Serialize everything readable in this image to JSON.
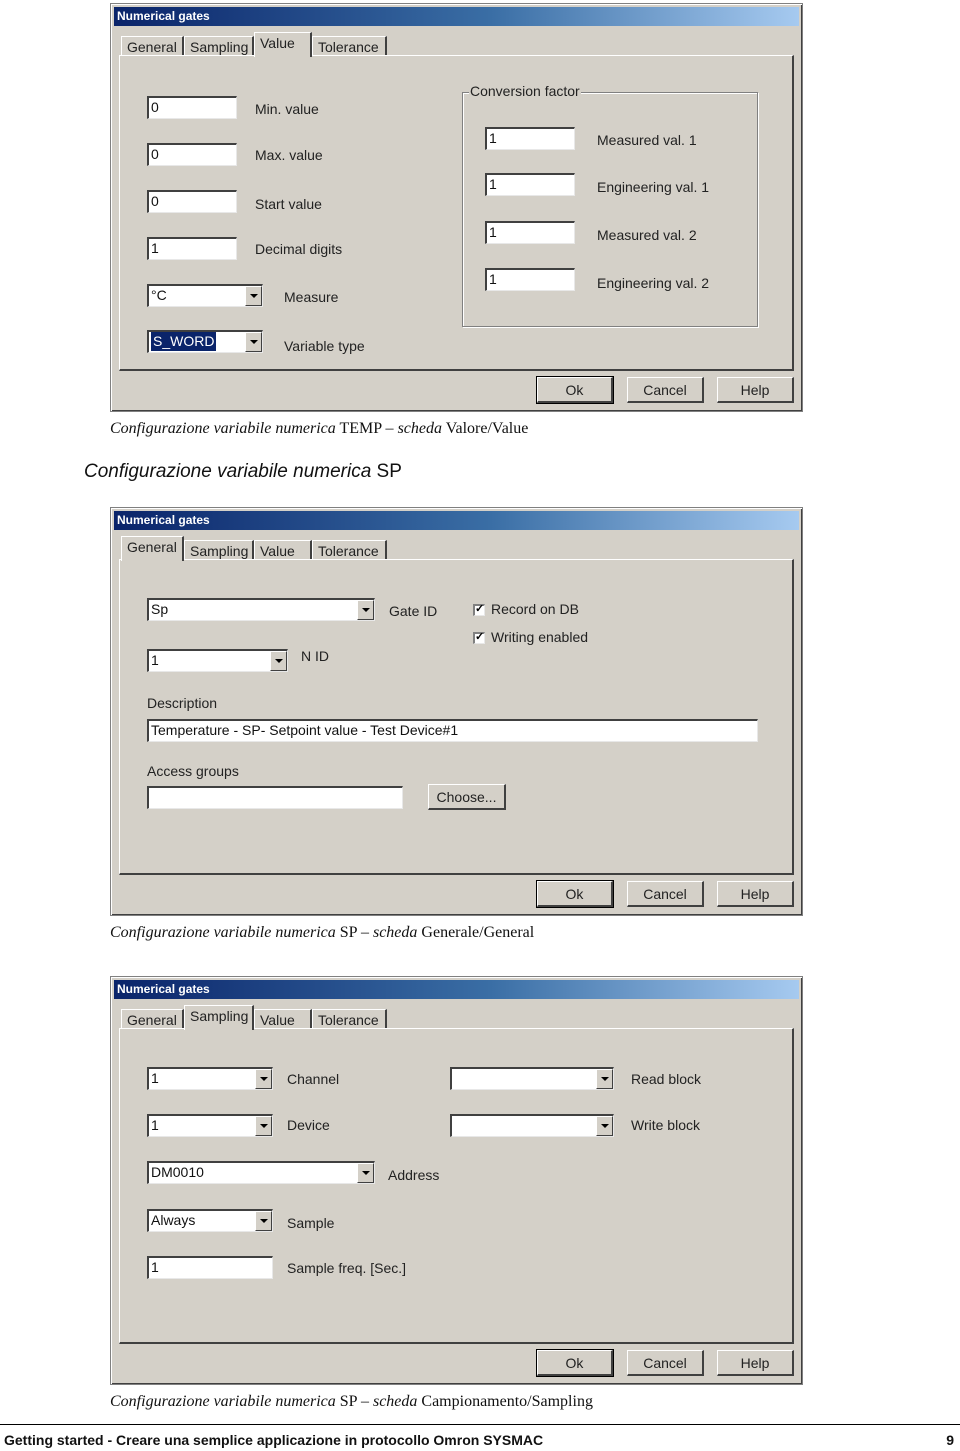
{
  "dialog_title": "Numerical gates",
  "tabs": [
    "General",
    "Sampling",
    "Value",
    "Tolerance"
  ],
  "buttons": {
    "ok": "Ok",
    "cancel": "Cancel",
    "help": "Help"
  },
  "dialog1": {
    "active_tab": "Value",
    "min_value": {
      "label": "Min. value",
      "value": "0"
    },
    "max_value": {
      "label": "Max. value",
      "value": "0"
    },
    "start_value": {
      "label": "Start value",
      "value": "0"
    },
    "decimal_digits": {
      "label": "Decimal digits",
      "value": "1"
    },
    "measure": {
      "label": "Measure",
      "value": "°C"
    },
    "variable_type": {
      "label": "Variable type",
      "value": "S_WORD"
    },
    "conversion": {
      "title": "Conversion factor",
      "measured1": {
        "label": "Measured val. 1",
        "value": "1"
      },
      "engineering1": {
        "label": "Engineering val. 1",
        "value": "1"
      },
      "measured2": {
        "label": "Measured val. 2",
        "value": "1"
      },
      "engineering2": {
        "label": "Engineering val. 2",
        "value": "1"
      }
    },
    "caption": {
      "italic1": "Configurazione variabile numerica",
      "plain1": " TEMP – ",
      "italic2": "scheda",
      "plain2": " Valore/Value"
    }
  },
  "section_heading": {
    "italic": "Configurazione variabile numerica",
    "plain": " SP"
  },
  "dialog2": {
    "active_tab": "General",
    "gate_id": {
      "label": "Gate ID",
      "value": "Sp"
    },
    "n_id": {
      "label": "N ID",
      "value": "1"
    },
    "record_on_db": {
      "label": "Record on DB",
      "checked": true
    },
    "writing_enabled": {
      "label": "Writing enabled",
      "checked": true
    },
    "description": {
      "label": "Description",
      "value": "Temperature - SP- Setpoint value - Test Device#1"
    },
    "access_groups": {
      "label": "Access groups",
      "value": ""
    },
    "choose_button": "Choose...",
    "caption": {
      "italic1": "Configurazione variabile numerica",
      "plain1": " SP – ",
      "italic2": "scheda",
      "plain2": " Generale/General"
    }
  },
  "dialog3": {
    "active_tab": "Sampling",
    "channel": {
      "label": "Channel",
      "value": "1"
    },
    "device": {
      "label": "Device",
      "value": "1"
    },
    "address": {
      "label": "Address",
      "value": "DM0010"
    },
    "sample": {
      "label": "Sample",
      "value": "Always"
    },
    "sample_freq": {
      "label": "Sample freq. [Sec.]",
      "value": "1"
    },
    "read_block": {
      "label": "Read block",
      "value": ""
    },
    "write_block": {
      "label": "Write block",
      "value": ""
    },
    "caption": {
      "italic1": "Configurazione variabile numerica",
      "plain1": " SP – ",
      "italic2": "scheda",
      "plain2": " Campionamento/Sampling"
    }
  },
  "footer": {
    "text": "Getting started - Creare una semplice applicazione in protocollo Omron SYSMAC",
    "page": "9"
  }
}
